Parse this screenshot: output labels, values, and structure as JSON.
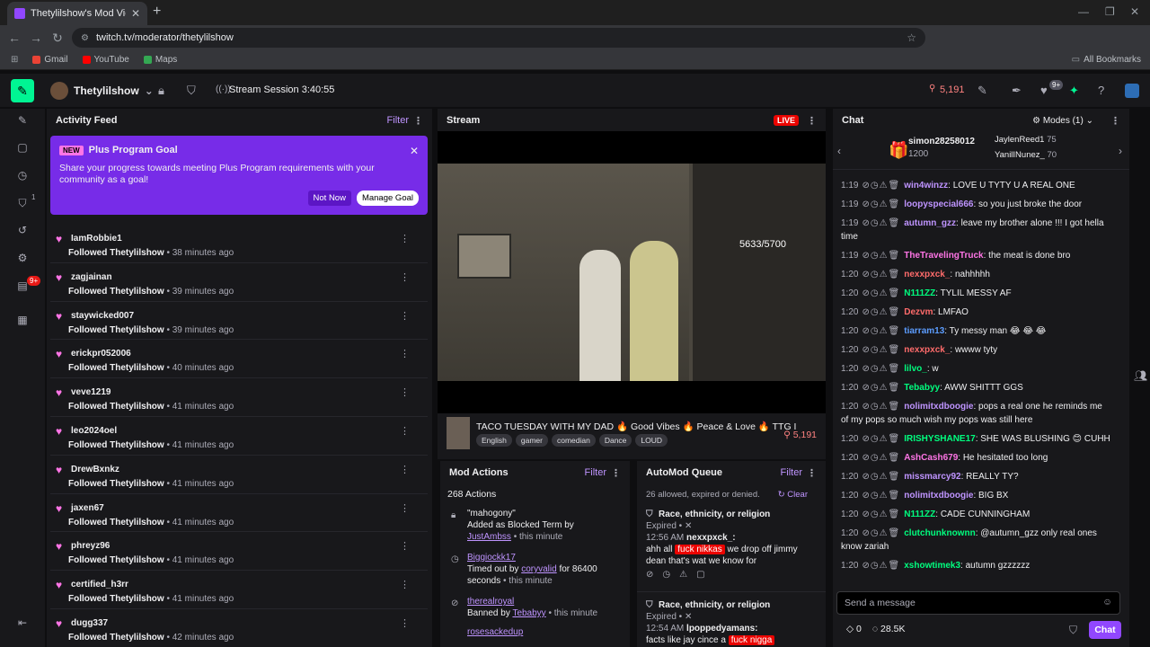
{
  "browser": {
    "tab_title": "Thetylilshow's Mod View -",
    "url": "twitch.tv/moderator/thetylilshow",
    "bookmarks": [
      "Gmail",
      "YouTube",
      "Maps"
    ],
    "all_bookmarks": "All Bookmarks"
  },
  "topbar": {
    "channel": "Thetylilshow",
    "session": "Stream Session 3:40:55",
    "viewers": "5,191",
    "notif_badge": "9+"
  },
  "rail": {
    "badge1": "1",
    "badge2": "9+"
  },
  "activity": {
    "title": "Activity Feed",
    "filter": "Filter",
    "goal": {
      "tag": "NEW",
      "title": "Plus Program Goal",
      "message": "Share your progress towards meeting Plus Program requirements with your community as a goal!",
      "not_now": "Not Now",
      "manage": "Manage Goal"
    },
    "items": [
      {
        "name": "IamRobbie1",
        "followed": "Followed",
        "channel": "Thetylilshow",
        "time": "• 38 minutes ago"
      },
      {
        "name": "zagjainan",
        "followed": "Followed",
        "channel": "Thetylilshow",
        "time": "• 39 minutes ago"
      },
      {
        "name": "staywicked007",
        "followed": "Followed",
        "channel": "Thetylilshow",
        "time": "• 39 minutes ago"
      },
      {
        "name": "erickpr052006",
        "followed": "Followed",
        "channel": "Thetylilshow",
        "time": "• 40 minutes ago"
      },
      {
        "name": "veve1219",
        "followed": "Followed",
        "channel": "Thetylilshow",
        "time": "• 41 minutes ago"
      },
      {
        "name": "leo2024oel",
        "followed": "Followed",
        "channel": "Thetylilshow",
        "time": "• 41 minutes ago"
      },
      {
        "name": "DrewBxnkz",
        "followed": "Followed",
        "channel": "Thetylilshow",
        "time": "• 41 minutes ago"
      },
      {
        "name": "jaxen67",
        "followed": "Followed",
        "channel": "Thetylilshow",
        "time": "• 41 minutes ago"
      },
      {
        "name": "phreyz96",
        "followed": "Followed",
        "channel": "Thetylilshow",
        "time": "• 41 minutes ago"
      },
      {
        "name": "certified_h3rr",
        "followed": "Followed",
        "channel": "Thetylilshow",
        "time": "• 41 minutes ago"
      },
      {
        "name": "dugg337",
        "followed": "Followed",
        "channel": "Thetylilshow",
        "time": "• 42 minutes ago"
      }
    ]
  },
  "stream": {
    "title": "Stream",
    "live": "LIVE",
    "overlay_count": "5633/5700",
    "stream_title": "TACO TUESDAY WITH MY DAD 🔥 Good Vibes 🔥 Peace & Love 🔥 TTG I",
    "tags": [
      "English",
      "gamer",
      "comedian",
      "Dance",
      "LOUD"
    ],
    "viewers": "5,191"
  },
  "mod_actions": {
    "title": "Mod Actions",
    "filter": "Filter",
    "count": "268 Actions",
    "items": [
      {
        "head": "\"mahogony\"",
        "line": "Added as Blocked Term by",
        "by": "JustAmbss",
        "when": "• this minute"
      },
      {
        "head": "Biggiockk17",
        "line": "Timed out by",
        "by": "coryvalid",
        "extra": "for 86400 seconds",
        "when": "• this minute"
      },
      {
        "head": "therealroyal",
        "line": "Banned by",
        "by": "Tebabyy",
        "when": "• this minute"
      },
      {
        "head": "rosesackedup"
      }
    ]
  },
  "automod": {
    "title": "AutoMod Queue",
    "filter": "Filter",
    "summary": "26 allowed, expired or denied.",
    "clear": "Clear",
    "items": [
      {
        "cat": "Race, ethnicity, or religion",
        "status": "Expired •",
        "time": "12:56 AM",
        "user": "nexxpxck_:",
        "pre": "ahh all",
        "flag": "fuck nikkas",
        "post": "we drop off jimmy dean that's wat we know for"
      },
      {
        "cat": "Race, ethnicity, or religion",
        "status": "Expired •",
        "time": "12:54 AM",
        "user": "lpoppedyamans:",
        "pre": "facts like jay cince a",
        "flag": "fuck nigga",
        "post": ""
      }
    ]
  },
  "chat": {
    "title": "Chat",
    "modes": "Modes (1)",
    "gifter": {
      "name": "simon28258012",
      "count": "1200"
    },
    "top": [
      {
        "name": "JaylenReed1",
        "count": "75"
      },
      {
        "name": "YanilINunez_",
        "count": "70"
      }
    ],
    "placeholder": "Send a message",
    "points": "0",
    "bits": "28.5K",
    "chat_button": "Chat",
    "messages": [
      {
        "t": "1:19",
        "u": "win4winzz",
        "c": "#bf94ff",
        "m": ": LOVE U TYTY U A REAL ONE"
      },
      {
        "t": "1:19",
        "u": "loopyspecial666",
        "c": "#bf94ff",
        "m": ": so you just broke the door"
      },
      {
        "t": "1:19",
        "u": "autumn_gzz",
        "c": "#bf94ff",
        "m": ": leave my brother alone !!! I got hella time"
      },
      {
        "t": "1:19",
        "u": "TheTravelingTruck",
        "c": "#ff75e6",
        "m": ": the meat is done bro"
      },
      {
        "t": "1:20",
        "u": "nexxpxck_",
        "c": "#ff6b6b",
        "m": ": nahhhhh"
      },
      {
        "t": "1:20",
        "u": "N111ZZ",
        "c": "#00ff7f",
        "m": ": TYLIL MESSY AF"
      },
      {
        "t": "1:20",
        "u": "Dezvm",
        "c": "#ff6b6b",
        "m": ": LMFAO"
      },
      {
        "t": "1:20",
        "u": "tiarram13",
        "c": "#5c9dff",
        "m": ": Ty messy man 😂 😂 😂"
      },
      {
        "t": "1:20",
        "u": "nexxpxck_",
        "c": "#ff6b6b",
        "m": ": wwww tyty"
      },
      {
        "t": "1:20",
        "u": "lilvo_",
        "c": "#00ff7f",
        "m": ": w"
      },
      {
        "t": "1:20",
        "u": "Tebabyy",
        "c": "#00ff7f",
        "m": ": AWW SHITTT GGS"
      },
      {
        "t": "1:20",
        "u": "nolimitxdboogie",
        "c": "#bf94ff",
        "m": ": pops a real one he reminds me of my pops so much wish my pops was still here"
      },
      {
        "t": "1:20",
        "u": "IRISHYSHANE17",
        "c": "#00ff7f",
        "m": ": SHE WAS BLUSHING 😊 CUHH"
      },
      {
        "t": "1:20",
        "u": "AshCash679",
        "c": "#ff75e6",
        "m": ": He hesitated too long"
      },
      {
        "t": "1:20",
        "u": "missmarcy92",
        "c": "#bf94ff",
        "m": ": REALLY TY?"
      },
      {
        "t": "1:20",
        "u": "nolimitxdboogie",
        "c": "#bf94ff",
        "m": ": BIG BX"
      },
      {
        "t": "1:20",
        "u": "N111ZZ",
        "c": "#00ff7f",
        "m": ": CADE CUNNINGHAM"
      },
      {
        "t": "1:20",
        "u": "clutchunknownn",
        "c": "#00ff7f",
        "m": ": @autumn_gzz only real ones know zariah"
      },
      {
        "t": "1:20",
        "u": "xshowtimek3",
        "c": "#00ff7f",
        "m": ": autumn gzzzzzz"
      }
    ]
  }
}
